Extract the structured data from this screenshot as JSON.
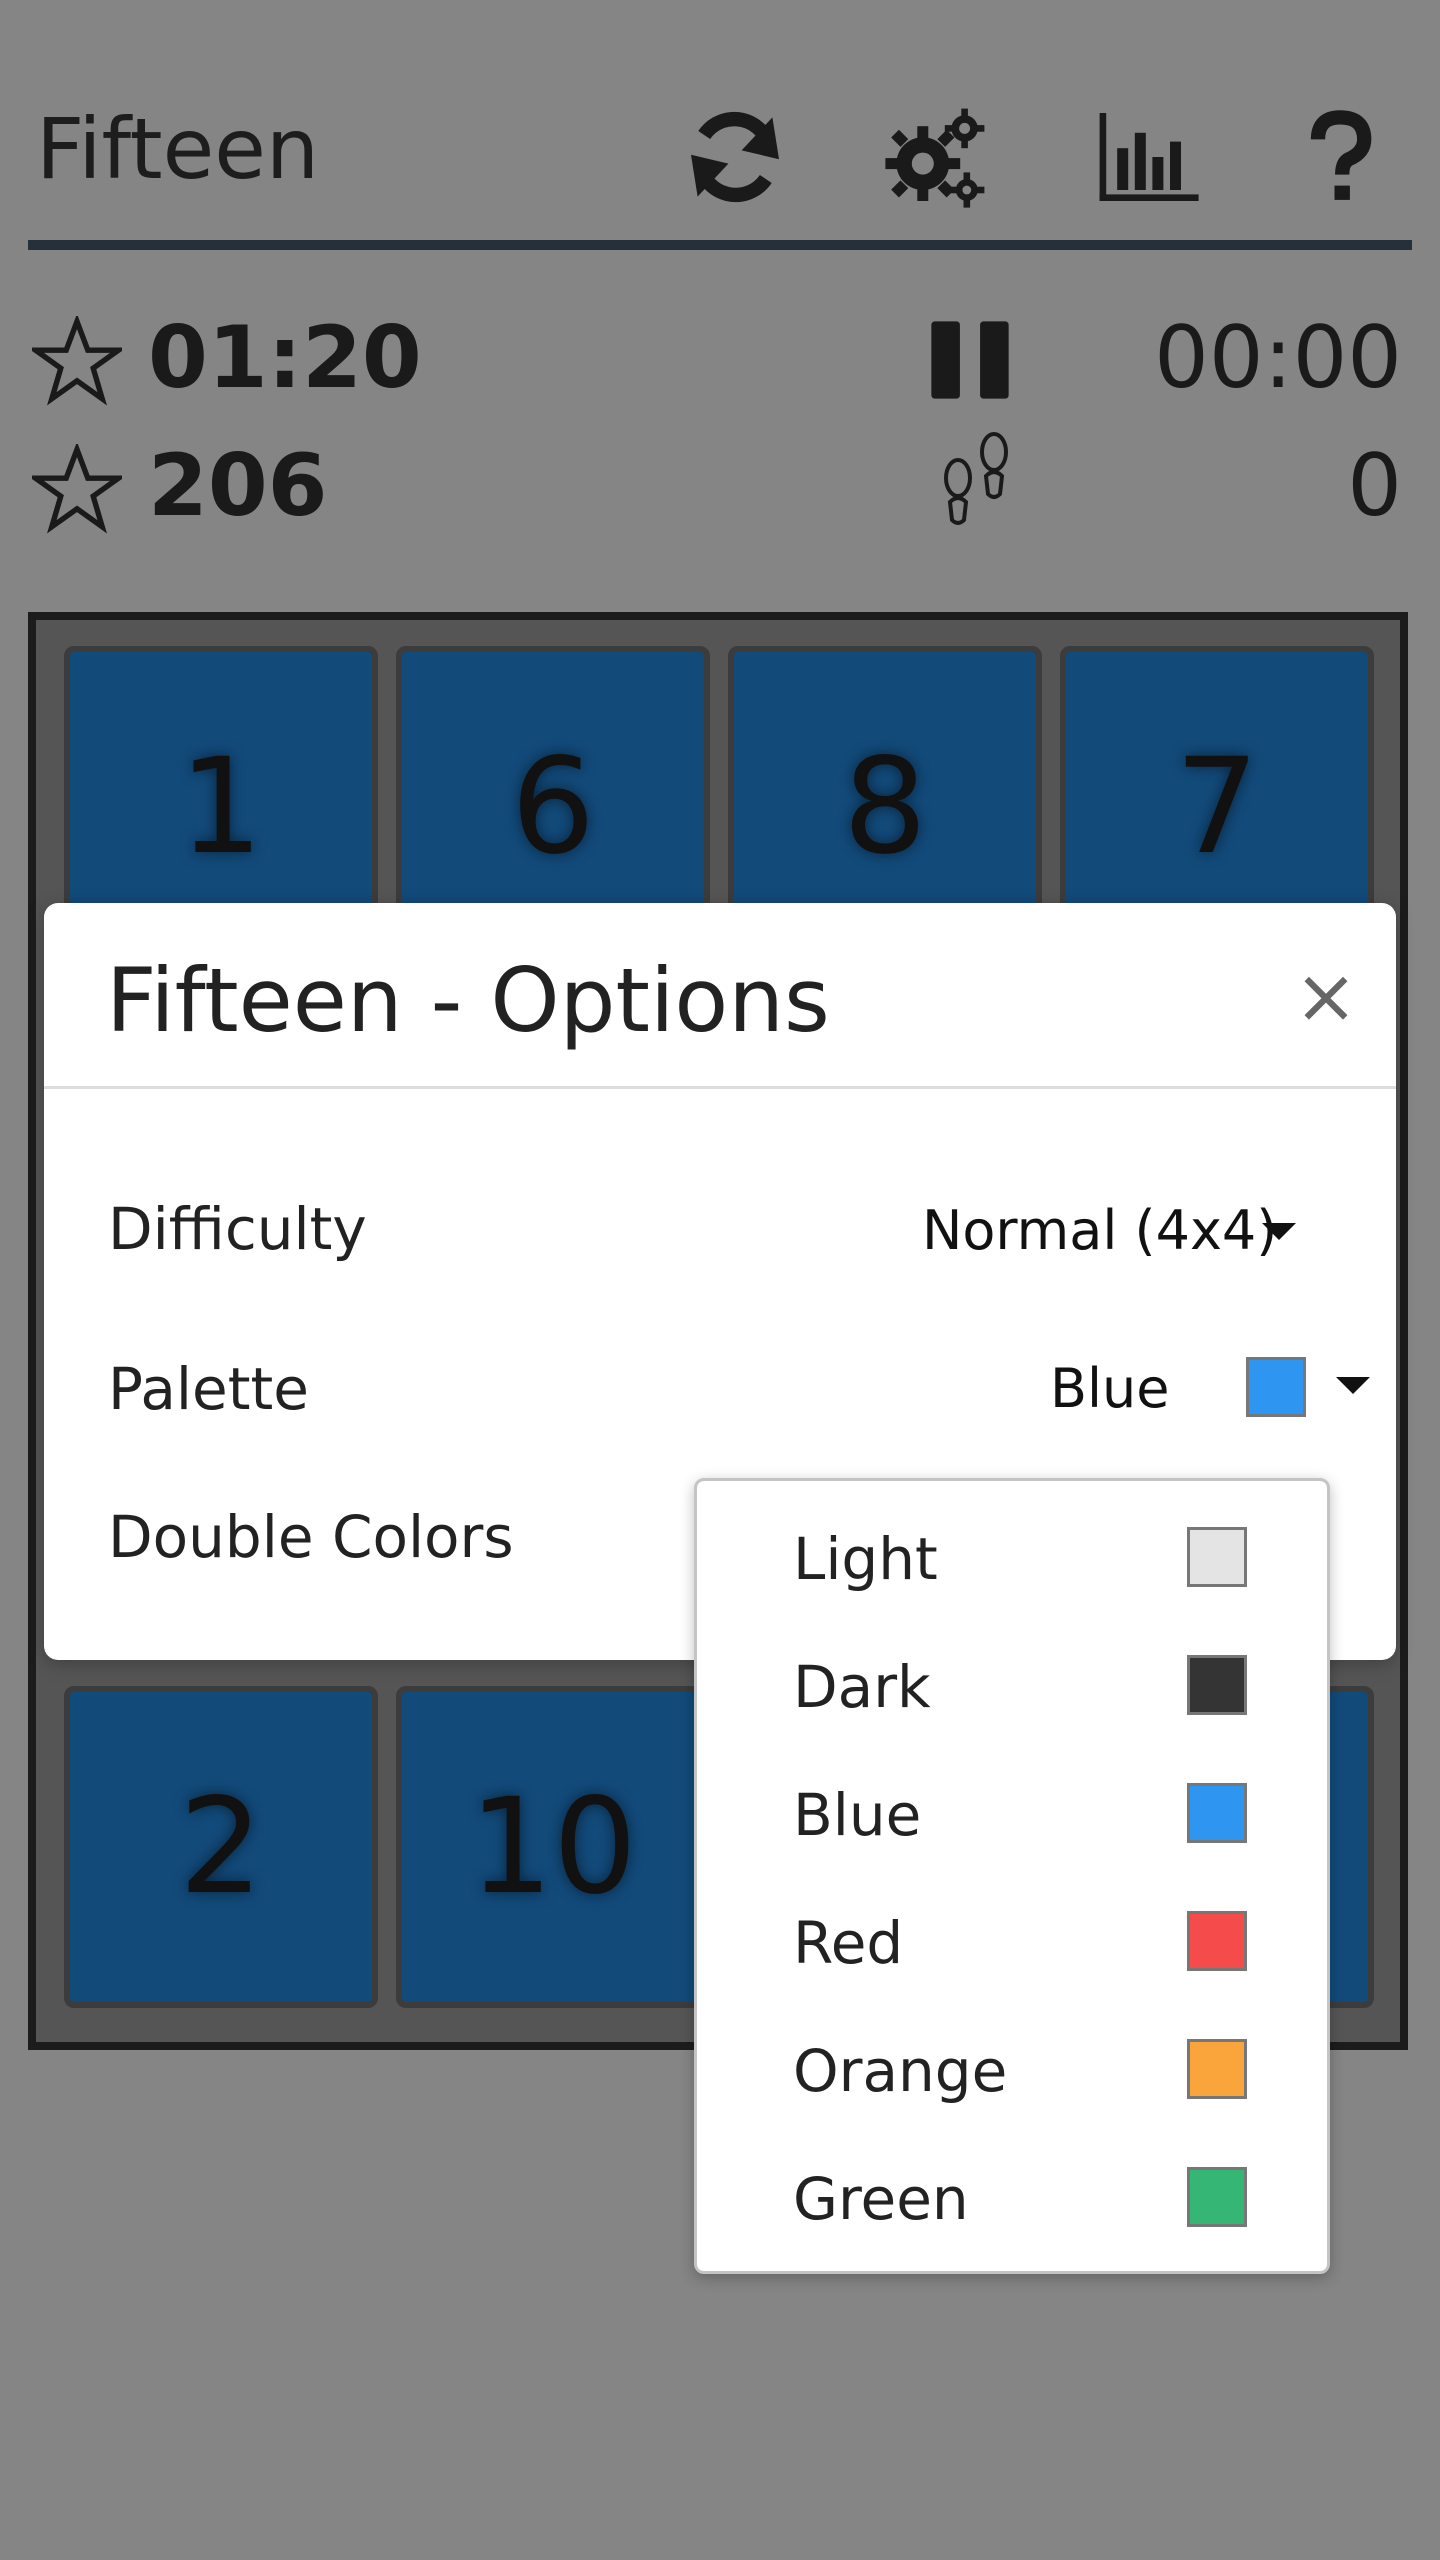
{
  "header": {
    "title": "Fifteen",
    "icons": [
      "refresh-icon",
      "gear-icon",
      "stats-icon",
      "help-icon"
    ]
  },
  "stats": {
    "best_time": "01:20",
    "best_moves": "206",
    "current_time": "00:00",
    "current_moves": "0"
  },
  "board": {
    "tile_color": "#124a7a",
    "tiles_visible": [
      "1",
      "6",
      "8",
      "7",
      "2",
      "10"
    ]
  },
  "options": {
    "title": "Fifteen - Options",
    "close_label": "×",
    "difficulty_label": "Difficulty",
    "difficulty_value": "Normal (4x4)",
    "palette_label": "Palette",
    "palette_value": "Blue",
    "palette_color": "#2e95f0",
    "double_colors_label": "Double Colors"
  },
  "palette_dropdown": {
    "items": [
      {
        "label": "Light",
        "color": "#e4e4e4"
      },
      {
        "label": "Dark",
        "color": "#343434"
      },
      {
        "label": "Blue",
        "color": "#2e95f0"
      },
      {
        "label": "Red",
        "color": "#f54b4b"
      },
      {
        "label": "Orange",
        "color": "#f9a53b"
      },
      {
        "label": "Green",
        "color": "#36b675"
      }
    ]
  }
}
